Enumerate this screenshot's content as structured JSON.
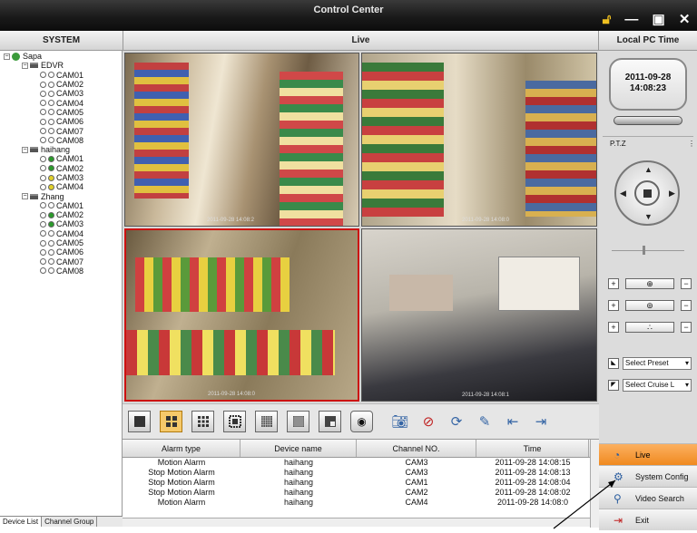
{
  "window": {
    "title": "Control Center"
  },
  "headers": {
    "system": "SYSTEM",
    "live": "Live",
    "local_time": "Local PC Time"
  },
  "tree": [
    {
      "type": "root",
      "label": "Sapa",
      "level": 0
    },
    {
      "type": "dvr",
      "label": "EDVR",
      "level": 1
    },
    {
      "type": "cam",
      "label": "CAM01",
      "level": 2,
      "status": "white"
    },
    {
      "type": "cam",
      "label": "CAM02",
      "level": 2,
      "status": "white"
    },
    {
      "type": "cam",
      "label": "CAM03",
      "level": 2,
      "status": "white"
    },
    {
      "type": "cam",
      "label": "CAM04",
      "level": 2,
      "status": "white"
    },
    {
      "type": "cam",
      "label": "CAM05",
      "level": 2,
      "status": "white"
    },
    {
      "type": "cam",
      "label": "CAM06",
      "level": 2,
      "status": "white"
    },
    {
      "type": "cam",
      "label": "CAM07",
      "level": 2,
      "status": "white"
    },
    {
      "type": "cam",
      "label": "CAM08",
      "level": 2,
      "status": "white"
    },
    {
      "type": "dvr",
      "label": "haihang",
      "level": 1
    },
    {
      "type": "cam",
      "label": "CAM01",
      "level": 2,
      "status": "green"
    },
    {
      "type": "cam",
      "label": "CAM02",
      "level": 2,
      "status": "green"
    },
    {
      "type": "cam",
      "label": "CAM03",
      "level": 2,
      "status": "yellow"
    },
    {
      "type": "cam",
      "label": "CAM04",
      "level": 2,
      "status": "yellow"
    },
    {
      "type": "dvr",
      "label": "Zhang",
      "level": 1
    },
    {
      "type": "cam",
      "label": "CAM01",
      "level": 2,
      "status": "white"
    },
    {
      "type": "cam",
      "label": "CAM02",
      "level": 2,
      "status": "green"
    },
    {
      "type": "cam",
      "label": "CAM03",
      "level": 2,
      "status": "green"
    },
    {
      "type": "cam",
      "label": "CAM04",
      "level": 2,
      "status": "white"
    },
    {
      "type": "cam",
      "label": "CAM05",
      "level": 2,
      "status": "white"
    },
    {
      "type": "cam",
      "label": "CAM06",
      "level": 2,
      "status": "white"
    },
    {
      "type": "cam",
      "label": "CAM07",
      "level": 2,
      "status": "white"
    },
    {
      "type": "cam",
      "label": "CAM08",
      "level": 2,
      "status": "white"
    }
  ],
  "tabs": [
    "Device List",
    "Channel Group"
  ],
  "video_stamps": [
    "2011-09-28 14:08:2",
    "2011-09-28 14:08:0",
    "2011-09-28 14:08:0",
    "2011-09-28 14:08:1"
  ],
  "clock": {
    "date": "2011-09-28",
    "time": "14:08:23"
  },
  "ptz": {
    "label": "P.T.Z",
    "preset": "Select Preset",
    "cruise": "Select Cruise L"
  },
  "alarms": {
    "columns": [
      "Alarm type",
      "Device name",
      "Channel NO.",
      "Time"
    ],
    "rows": [
      [
        "Motion Alarm",
        "haihang",
        "CAM3",
        "2011-09-28 14:08:15"
      ],
      [
        "Stop Motion Alarm",
        "haihang",
        "CAM3",
        "2011-09-28 14:08:13"
      ],
      [
        "Stop Motion Alarm",
        "haihang",
        "CAM1",
        "2011-09-28 14:08:04"
      ],
      [
        "Stop Motion Alarm",
        "haihang",
        "CAM2",
        "2011-09-28 14:08:02"
      ],
      [
        "Motion Alarm",
        "haihang",
        "CAM4",
        "2011-09-28 14:08:0"
      ]
    ]
  },
  "menu": [
    "Live",
    "System Config",
    "Video Search",
    "Exit"
  ],
  "colors": {
    "accent": "#f08a20",
    "selected_border": "#cc1111"
  }
}
